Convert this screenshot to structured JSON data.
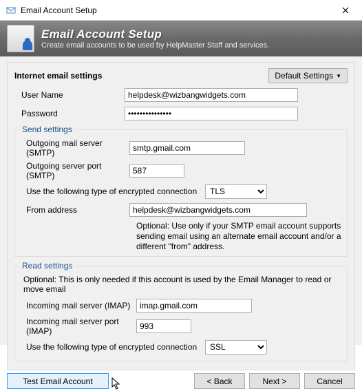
{
  "window": {
    "title": "Email Account Setup"
  },
  "header": {
    "title": "Email Account Setup",
    "subtitle": "Create email accounts to be used by HelpMaster Staff and services."
  },
  "panel": {
    "heading": "Internet email settings",
    "default_btn": "Default Settings"
  },
  "fields": {
    "username_label": "User Name",
    "username_value": "helpdesk@wizbangwidgets.com",
    "password_label": "Password",
    "password_value": "•••••••••••••••"
  },
  "send": {
    "legend": "Send settings",
    "server_label": "Outgoing mail server (SMTP)",
    "server_value": "smtp.gmail.com",
    "port_label": "Outgoing server port (SMTP)",
    "port_value": "587",
    "enc_label": "Use the following type of encrypted connection",
    "enc_value": "TLS",
    "from_label": "From address",
    "from_value": "helpdesk@wizbangwidgets.com",
    "note": "Optional: Use only if your SMTP email account supports sending email using an alternate email account and/or a different \"from\" address."
  },
  "read": {
    "legend": "Read settings",
    "note": "Optional: This is only needed if this account is used by the Email Manager to read or move email",
    "server_label": "Incoming mail server (IMAP)",
    "server_value": "imap.gmail.com",
    "port_label": "Incoming mail server port (IMAP)",
    "port_value": "993",
    "enc_label": "Use the following type of encrypted connection",
    "enc_value": "SSL"
  },
  "buttons": {
    "test": "Test Email Account",
    "back": "< Back",
    "next": "Next >",
    "cancel": "Cancel"
  }
}
